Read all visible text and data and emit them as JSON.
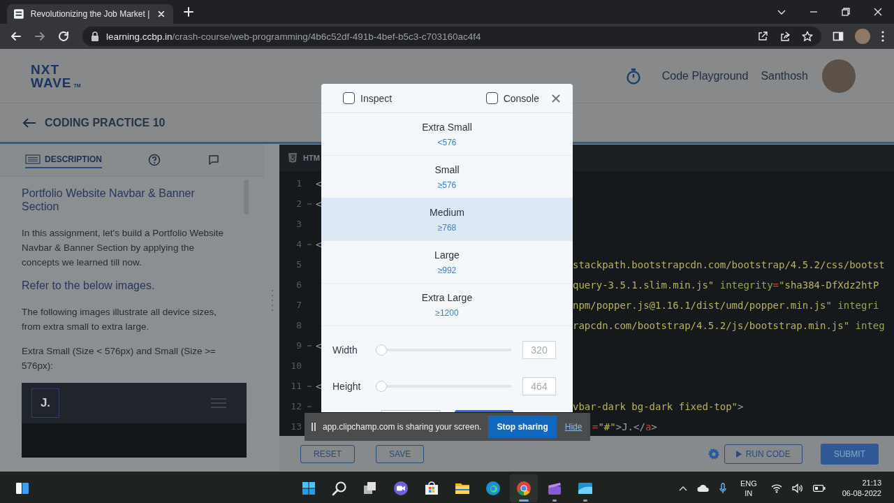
{
  "browser": {
    "tab": {
      "title": "Revolutionizing the Job Market |",
      "selected": true
    },
    "url_host": "learning.ccbp.in",
    "url_path": "/crash-course/web-programming/4b6c52df-491b-4bef-b5c3-c703160ac4f4"
  },
  "header": {
    "logo": [
      "NXT",
      "WAVE"
    ],
    "logo_mark": "TM",
    "link": "Code Playground",
    "user": "Santhosh"
  },
  "practice_title": "CODING PRACTICE 10",
  "left_panel": {
    "tabs": [
      {
        "kind": "description",
        "label": "DESCRIPTION",
        "selected": true
      },
      {
        "kind": "help",
        "selected": false
      },
      {
        "kind": "chat",
        "selected": false
      }
    ],
    "title": "Portfolio Website Navbar & Banner Section",
    "blocks": [
      {
        "kind": "paragraph",
        "text": "In this assignment, let's build a Portfolio Website Navbar & Banner Section by applying the concepts we learned till now."
      },
      {
        "kind": "heading",
        "text": "Refer to the below images."
      },
      {
        "kind": "paragraph",
        "text": "The following images illustrate all device sizes, from extra small to extra large."
      },
      {
        "kind": "paragraph",
        "text": "Extra Small (Size < 576px) and Small (Size >= 576px):"
      }
    ],
    "preview": {
      "brand": "J."
    }
  },
  "editor": {
    "tab": "HTM",
    "lines": [
      {
        "number": "1",
        "fold": false,
        "start": "<"
      },
      {
        "number": "2",
        "fold": true,
        "start": "<"
      },
      {
        "number": "3",
        "fold": false
      },
      {
        "number": "4",
        "fold": true,
        "start": "<"
      },
      {
        "number": "5",
        "fold": false,
        "end": [
          {
            "kind": "string",
            "text": "stackpath.bootstrapcdn.com/bootstrap/4.5.2/css/bootst"
          }
        ]
      },
      {
        "number": "6",
        "fold": false,
        "end": [
          {
            "kind": "string",
            "text": "query-3.5.1.slim.min.js\""
          },
          {
            "kind": "attr",
            "text": " integrity"
          },
          {
            "kind": "punct",
            "text": "="
          },
          {
            "kind": "string",
            "text": "\"sha384-DfXdz2htP"
          }
        ]
      },
      {
        "number": "7",
        "fold": false,
        "end": [
          {
            "kind": "string",
            "text": "npm/popper.js@1.16.1/dist/umd/popper.min.js\""
          },
          {
            "kind": "attr",
            "text": " integri"
          }
        ]
      },
      {
        "number": "8",
        "fold": false,
        "end": [
          {
            "kind": "string",
            "text": "rapcdn.com/bootstrap/4.5.2/js/bootstrap.min.js\""
          },
          {
            "kind": "attr",
            "text": " integ"
          }
        ]
      },
      {
        "number": "9",
        "fold": true,
        "start": "<"
      },
      {
        "number": "10",
        "fold": false
      },
      {
        "number": "11",
        "fold": true,
        "start": "<"
      },
      {
        "number": "12",
        "fold": true,
        "end": [
          {
            "kind": "string",
            "text": "vbar-dark bg-dark fixed-top\""
          },
          {
            "kind": "tag",
            "text": ">"
          }
        ]
      },
      {
        "number": "13",
        "fold": false,
        "end": [
          {
            "kind": "punct",
            "text": "="
          },
          {
            "kind": "string",
            "text": "\"#\""
          },
          {
            "kind": "tag",
            "text": ">J.</"
          },
          {
            "kind": "punct",
            "text": "a"
          },
          {
            "kind": "tag",
            "text": ">"
          }
        ]
      }
    ]
  },
  "actions": [
    {
      "kind": "outline",
      "label": "RESET"
    },
    {
      "kind": "outline",
      "label": "SAVE"
    },
    {
      "kind": "settings"
    },
    {
      "kind": "run",
      "label": "RUN CODE"
    },
    {
      "kind": "primary",
      "label": "SUBMIT"
    }
  ],
  "modal": {
    "toggles": [
      {
        "label": "Inspect",
        "checked": false
      },
      {
        "label": "Console",
        "checked": false
      }
    ],
    "breakpoints": [
      {
        "name": "Extra Small",
        "range": "<576",
        "selected": false
      },
      {
        "name": "Small",
        "range": "≥576",
        "selected": false
      },
      {
        "name": "Medium",
        "range": "≥768",
        "selected": true
      },
      {
        "name": "Large",
        "range": "≥992",
        "selected": false
      },
      {
        "name": "Extra Large",
        "range": "≥1200",
        "selected": false
      }
    ],
    "sliders": [
      {
        "label": "Width",
        "level": 0,
        "value": "320"
      },
      {
        "label": "Height",
        "level": 0,
        "value": "464"
      }
    ],
    "footer_buttons": [
      {
        "kind": "outline"
      },
      {
        "kind": "primary"
      }
    ]
  },
  "share_bar": {
    "message": "app.clipchamp.com is sharing your screen.",
    "stop": "Stop sharing",
    "hide": "Hide"
  },
  "taskbar": {
    "apps": [
      {
        "kind": "widgets",
        "running": false,
        "active": false
      },
      {
        "kind": "start",
        "running": false,
        "active": false
      },
      {
        "kind": "search",
        "running": false,
        "active": false
      },
      {
        "kind": "taskview",
        "running": false,
        "active": false
      },
      {
        "kind": "chat",
        "running": false,
        "active": false
      },
      {
        "kind": "store",
        "running": false,
        "active": false
      },
      {
        "kind": "explorer",
        "running": false,
        "active": false
      },
      {
        "kind": "edge",
        "running": false,
        "active": false
      },
      {
        "kind": "chrome",
        "running": true,
        "active": true
      },
      {
        "kind": "clipchamp",
        "running": true,
        "active": false
      },
      {
        "kind": "app",
        "running": true,
        "active": false
      }
    ],
    "language": [
      "ENG",
      "IN"
    ],
    "time": "21:13",
    "date": "06-08-2022"
  }
}
